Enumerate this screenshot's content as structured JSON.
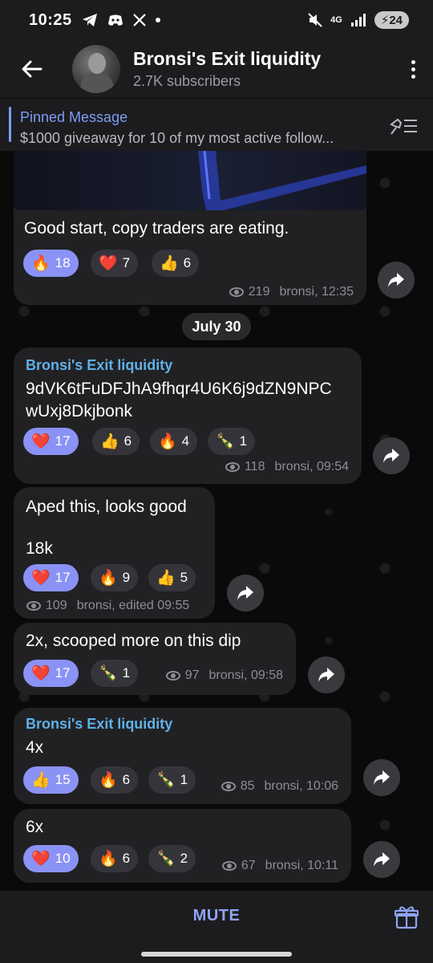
{
  "status": {
    "time": "10:25",
    "network": "4G",
    "battery": "24"
  },
  "header": {
    "title": "Bronsi's Exit liquidity",
    "subtitle": "2.7K subscribers"
  },
  "pinned": {
    "label": "Pinned Message",
    "text": "$1000 giveaway for 10 of my most active follow..."
  },
  "messages": [
    {
      "text": "Good start, copy traders are eating.",
      "reactions": [
        {
          "emoji": "🔥",
          "count": "18"
        },
        {
          "emoji": "❤️",
          "count": "7"
        },
        {
          "emoji": "👍",
          "count": "6"
        }
      ],
      "views": "219",
      "meta": "bronsi, 12:35"
    },
    {
      "sender": "Bronsi's Exit liquidity",
      "line1": "9dVK6tFuDFJhA9fhqr4U6K6j9dZN9NPC",
      "line2": "wUxj8Dkjbonk",
      "reactions": [
        {
          "emoji": "❤️",
          "count": "17"
        },
        {
          "emoji": "👍",
          "count": "6"
        },
        {
          "emoji": "🔥",
          "count": "4"
        },
        {
          "emoji": "🍾",
          "count": "1"
        }
      ],
      "views": "118",
      "meta": "bronsi, 09:54"
    },
    {
      "line1": "Aped this, looks good",
      "line2": "18k",
      "reactions": [
        {
          "emoji": "❤️",
          "count": "17"
        },
        {
          "emoji": "🔥",
          "count": "9"
        },
        {
          "emoji": "👍",
          "count": "5"
        }
      ],
      "views": "109",
      "meta": "bronsi, edited 09:55"
    },
    {
      "text": "2x, scooped more on this dip",
      "reactions": [
        {
          "emoji": "❤️",
          "count": "17"
        },
        {
          "emoji": "🍾",
          "count": "1"
        }
      ],
      "views": "97",
      "meta": "bronsi, 09:58"
    },
    {
      "sender": "Bronsi's Exit liquidity",
      "text": "4x",
      "reactions": [
        {
          "emoji": "👍",
          "count": "15"
        },
        {
          "emoji": "🔥",
          "count": "6"
        },
        {
          "emoji": "🍾",
          "count": "1"
        }
      ],
      "views": "85",
      "meta": "bronsi, 10:06"
    },
    {
      "text": "6x",
      "reactions": [
        {
          "emoji": "❤️",
          "count": "10"
        },
        {
          "emoji": "🔥",
          "count": "6"
        },
        {
          "emoji": "🍾",
          "count": "2"
        }
      ],
      "views": "67",
      "meta": "bronsi, 10:11"
    }
  ],
  "date_separator": "July 30",
  "bottom": {
    "mute_label": "MUTE"
  },
  "colors": {
    "accent": "#8a93f5",
    "bubble": "#212124",
    "link": "#5fb1e8"
  }
}
